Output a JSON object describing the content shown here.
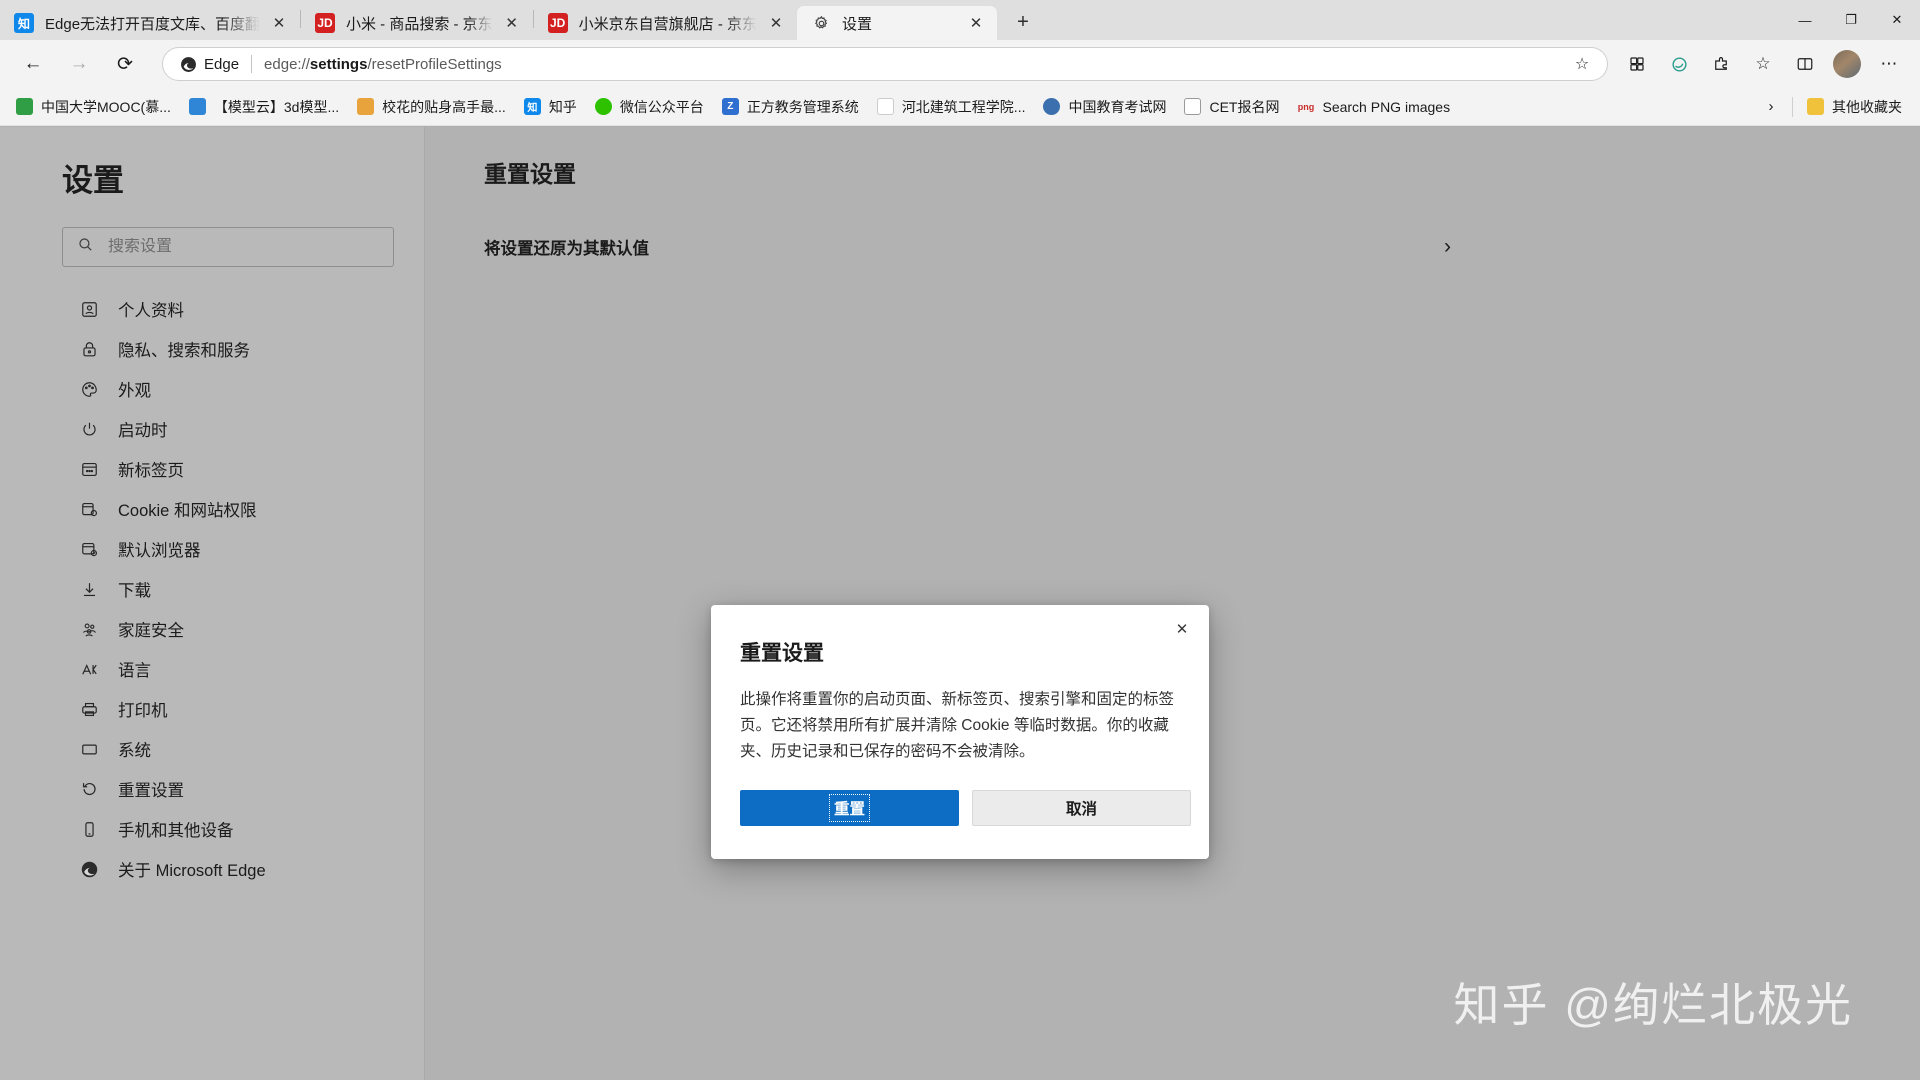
{
  "browser": {
    "tabs": [
      {
        "title": "Edge无法打开百度文库、百度翻",
        "favicon": "zhihu-icon",
        "active": false
      },
      {
        "title": "小米 - 商品搜索 - 京东",
        "favicon": "jd-icon",
        "active": false
      },
      {
        "title": "小米京东自营旗舰店 - 京东",
        "favicon": "jd-icon",
        "active": false
      },
      {
        "title": "设置",
        "favicon": "gear-icon",
        "active": true
      }
    ],
    "new_tab_label": "+",
    "window_controls": {
      "minimize": "—",
      "maximize": "❐",
      "close": "✕"
    },
    "nav": {
      "back": "←",
      "forward": "→",
      "reload": "⟳"
    },
    "omnibox": {
      "brand": "Edge",
      "url_prefix": "edge://",
      "url_bold": "settings",
      "url_suffix": "/resetProfileSettings",
      "favorite_icon": "☆"
    },
    "toolbar_icons": [
      "collections-icon",
      "copilot-icon",
      "extensions-icon",
      "favorites-icon",
      "split-screen-icon",
      "profile-avatar",
      "more-icon"
    ],
    "bookmarks": [
      {
        "label": "中国大学MOOC(慕...",
        "icon": "mooc-icon",
        "color": "#2f9e44"
      },
      {
        "label": "【模型云】3d模型...",
        "icon": "modelcloud-icon",
        "color": "#2f86d6"
      },
      {
        "label": "校花的贴身高手最...",
        "icon": "novel-icon",
        "color": "#e8a33d"
      },
      {
        "label": "知乎",
        "icon": "zhihu-icon",
        "color": "#0f88eb"
      },
      {
        "label": "微信公众平台",
        "icon": "wechat-icon",
        "color": "#2dc100"
      },
      {
        "label": "正方教务管理系统",
        "icon": "zfsoft-icon",
        "color": "#2f6fd0"
      },
      {
        "label": "河北建筑工程学院...",
        "icon": "generic-page-icon",
        "color": "#ffffff"
      },
      {
        "label": "中国教育考试网",
        "icon": "neea-icon",
        "color": "#3b6fae"
      },
      {
        "label": "CET报名网",
        "icon": "document-icon",
        "color": "#ffffff"
      },
      {
        "label": "Search PNG images",
        "icon": "png-icon",
        "color": "#c92a2a"
      }
    ],
    "bookmarks_overflow": "›",
    "other_favorites": {
      "label": "其他收藏夹",
      "icon": "folder-icon"
    }
  },
  "settings": {
    "sidebar": {
      "title": "设置",
      "search": {
        "placeholder": "搜索设置",
        "value": "",
        "icon": "search-icon"
      },
      "items": [
        {
          "label": "个人资料",
          "icon": "profile-icon"
        },
        {
          "label": "隐私、搜索和服务",
          "icon": "lock-icon"
        },
        {
          "label": "外观",
          "icon": "palette-icon"
        },
        {
          "label": "启动时",
          "icon": "power-icon"
        },
        {
          "label": "新标签页",
          "icon": "new-tab-page-icon"
        },
        {
          "label": "Cookie 和网站权限",
          "icon": "cookie-permissions-icon"
        },
        {
          "label": "默认浏览器",
          "icon": "default-browser-icon"
        },
        {
          "label": "下载",
          "icon": "download-icon"
        },
        {
          "label": "家庭安全",
          "icon": "family-safety-icon"
        },
        {
          "label": "语言",
          "icon": "language-icon"
        },
        {
          "label": "打印机",
          "icon": "printer-icon"
        },
        {
          "label": "系统",
          "icon": "system-icon"
        },
        {
          "label": "重置设置",
          "icon": "reset-icon"
        },
        {
          "label": "手机和其他设备",
          "icon": "phone-icon"
        },
        {
          "label": "关于 Microsoft Edge",
          "icon": "edge-logo-icon"
        }
      ]
    },
    "content": {
      "heading": "重置设置",
      "restore_row_label": "将设置还原为其默认值",
      "restore_row_chevron": "›"
    }
  },
  "dialog": {
    "title": "重置设置",
    "body": "此操作将重置你的启动页面、新标签页、搜索引擎和固定的标签页。它还将禁用所有扩展并清除 Cookie 等临时数据。你的收藏夹、历史记录和已保存的密码不会被清除。",
    "confirm_label": "重置",
    "cancel_label": "取消",
    "close_icon": "✕",
    "confirm_color": "#0d6cc4"
  },
  "watermark": {
    "text": "知乎 @绚烂北极光"
  }
}
